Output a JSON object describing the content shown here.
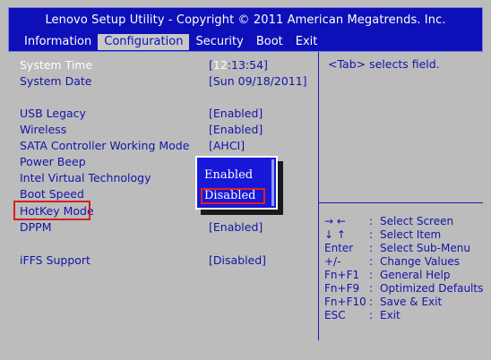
{
  "title": "Lenovo Setup Utility - Copyright © 2011 American Megatrends. Inc.",
  "tabs": [
    {
      "label": "Information"
    },
    {
      "label": "Configuration"
    },
    {
      "label": "Security"
    },
    {
      "label": "Boot"
    },
    {
      "label": "Exit"
    }
  ],
  "settings": [
    {
      "label": "System Time",
      "value": "[12:13:54]"
    },
    {
      "label": "System Date",
      "value": "[Sun 09/18/2011]"
    },
    {
      "label": "USB Legacy",
      "value": "[Enabled]"
    },
    {
      "label": "Wireless",
      "value": "[Enabled]"
    },
    {
      "label": "SATA Controller Working Mode",
      "value": "[AHCI]"
    },
    {
      "label": "Power Beep",
      "value": ""
    },
    {
      "label": "Intel Virtual Technology",
      "value": ""
    },
    {
      "label": "Boot Speed",
      "value": ""
    },
    {
      "label": "HotKey Mode",
      "value": ""
    },
    {
      "label": "DPPM",
      "value": "[Enabled]"
    },
    {
      "label": "iFFS Support",
      "value": "[Disabled]"
    }
  ],
  "time_parts": {
    "open": "[",
    "highlight": "12",
    "rest": ":13:54]"
  },
  "help_text": "<Tab> selects field.",
  "keys": [
    {
      "key": "→ ←",
      "sep": ":",
      "desc": "Select Screen"
    },
    {
      "key": "↓ ↑",
      "sep": ":",
      "desc": "Select Item"
    },
    {
      "key": "Enter",
      "sep": ":",
      "desc": "Select Sub-Menu"
    },
    {
      "key": "+/-",
      "sep": ":",
      "desc": "Change Values"
    },
    {
      "key": "Fn+F1",
      "sep": ":",
      "desc": "General Help"
    },
    {
      "key": "Fn+F9",
      "sep": ":",
      "desc": "Optimized Defaults"
    },
    {
      "key": "Fn+F10",
      "sep": ":",
      "desc": "Save & Exit"
    },
    {
      "key": "ESC",
      "sep": ":",
      "desc": "Exit"
    }
  ],
  "popup": {
    "options": [
      "Enabled",
      "Disabled"
    ],
    "selected": "Disabled"
  },
  "colors": {
    "header_bg": "#0d0fb8",
    "text_blue": "#1414a8",
    "screen_bg": "#bcbcbc",
    "highlight_red": "#d42020"
  }
}
